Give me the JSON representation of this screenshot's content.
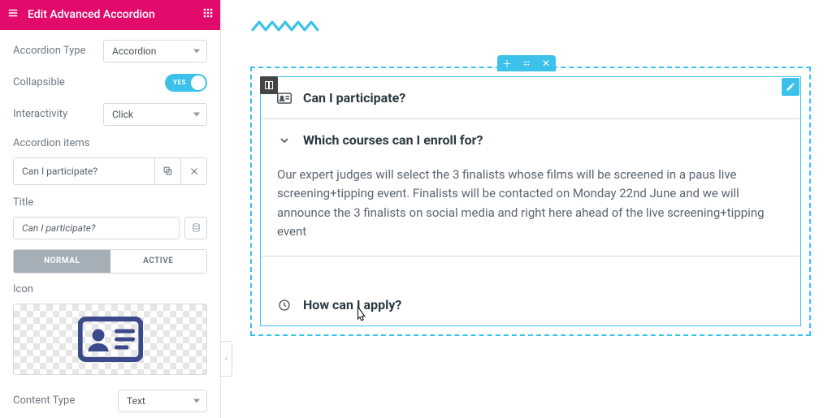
{
  "sidebar": {
    "title": "Edit Advanced Accordion",
    "rows": {
      "type_label": "Accordion Type",
      "type_value": "Accordion",
      "collapsible_label": "Collapsible",
      "collapsible_value": "YES",
      "interactivity_label": "Interactivity",
      "interactivity_value": "Click"
    },
    "items_label": "Accordion items",
    "item0": {
      "title": "Can I participate?"
    },
    "editor": {
      "title_label": "Title",
      "title_value": "Can I participate?",
      "tab_normal": "NORMAL",
      "tab_active": "ACTIVE",
      "icon_label": "Icon",
      "content_type_label": "Content Type",
      "content_type_value": "Text"
    }
  },
  "canvas": {
    "items": [
      {
        "title": "Can I participate?",
        "icon": "id-card-icon"
      },
      {
        "title": "Which courses can I enroll for?",
        "icon": "chevron-down-icon",
        "body": "Our expert judges will select the 3 finalists whose films will be screened in a paus live screening+tipping event. Finalists will be contacted on Monday 22nd June and we will announce the 3 finalists on social media and right here ahead of the live screening+tipping event"
      },
      {
        "title": "How can I apply?",
        "icon": "clock-icon"
      }
    ]
  }
}
